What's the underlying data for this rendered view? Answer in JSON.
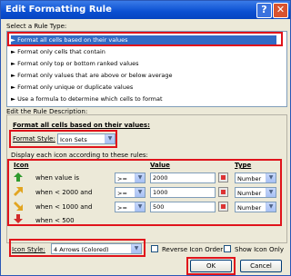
{
  "window": {
    "title": "Edit Formatting Rule"
  },
  "rule_type": {
    "label": "Select a Rule Type:",
    "items": [
      {
        "label": "Format all cells based on their values",
        "selected": true
      },
      {
        "label": "Format only cells that contain",
        "selected": false
      },
      {
        "label": "Format only top or bottom ranked values",
        "selected": false
      },
      {
        "label": "Format only values that are above or below average",
        "selected": false
      },
      {
        "label": "Format only unique or duplicate values",
        "selected": false
      },
      {
        "label": "Use a formula to determine which cells to format",
        "selected": false
      }
    ]
  },
  "description": {
    "label": "Edit the Rule Description:",
    "heading": "Format all cells based on their values:",
    "format_style_label": "Format Style:",
    "format_style_value": "Icon Sets",
    "display_text": "Display each icon according to these rules:",
    "col_icon": "Icon",
    "col_value": "Value",
    "col_type": "Type",
    "rows": [
      {
        "icon": "arrow-up-icon",
        "condition": "when value is",
        "operator": ">=",
        "value": "2000",
        "type": "Number"
      },
      {
        "icon": "arrow-up-right-icon",
        "condition": "when < 2000 and",
        "operator": ">=",
        "value": "1000",
        "type": "Number"
      },
      {
        "icon": "arrow-down-right-icon",
        "condition": "when < 1000 and",
        "operator": ">=",
        "value": "500",
        "type": "Number"
      },
      {
        "icon": "arrow-down-icon",
        "condition": "when < 500"
      }
    ],
    "icon_style_label": "Icon Style:",
    "icon_style_value": "4 Arrows (Colored)",
    "reverse_label": "Reverse Icon Order",
    "show_icon_only_label": "Show Icon Only"
  },
  "buttons": {
    "ok": "OK",
    "cancel": "Cancel"
  },
  "colors": {
    "selection": "#316ac5",
    "highlight": "#e0131b",
    "titlebar": "#0a4fd1"
  }
}
